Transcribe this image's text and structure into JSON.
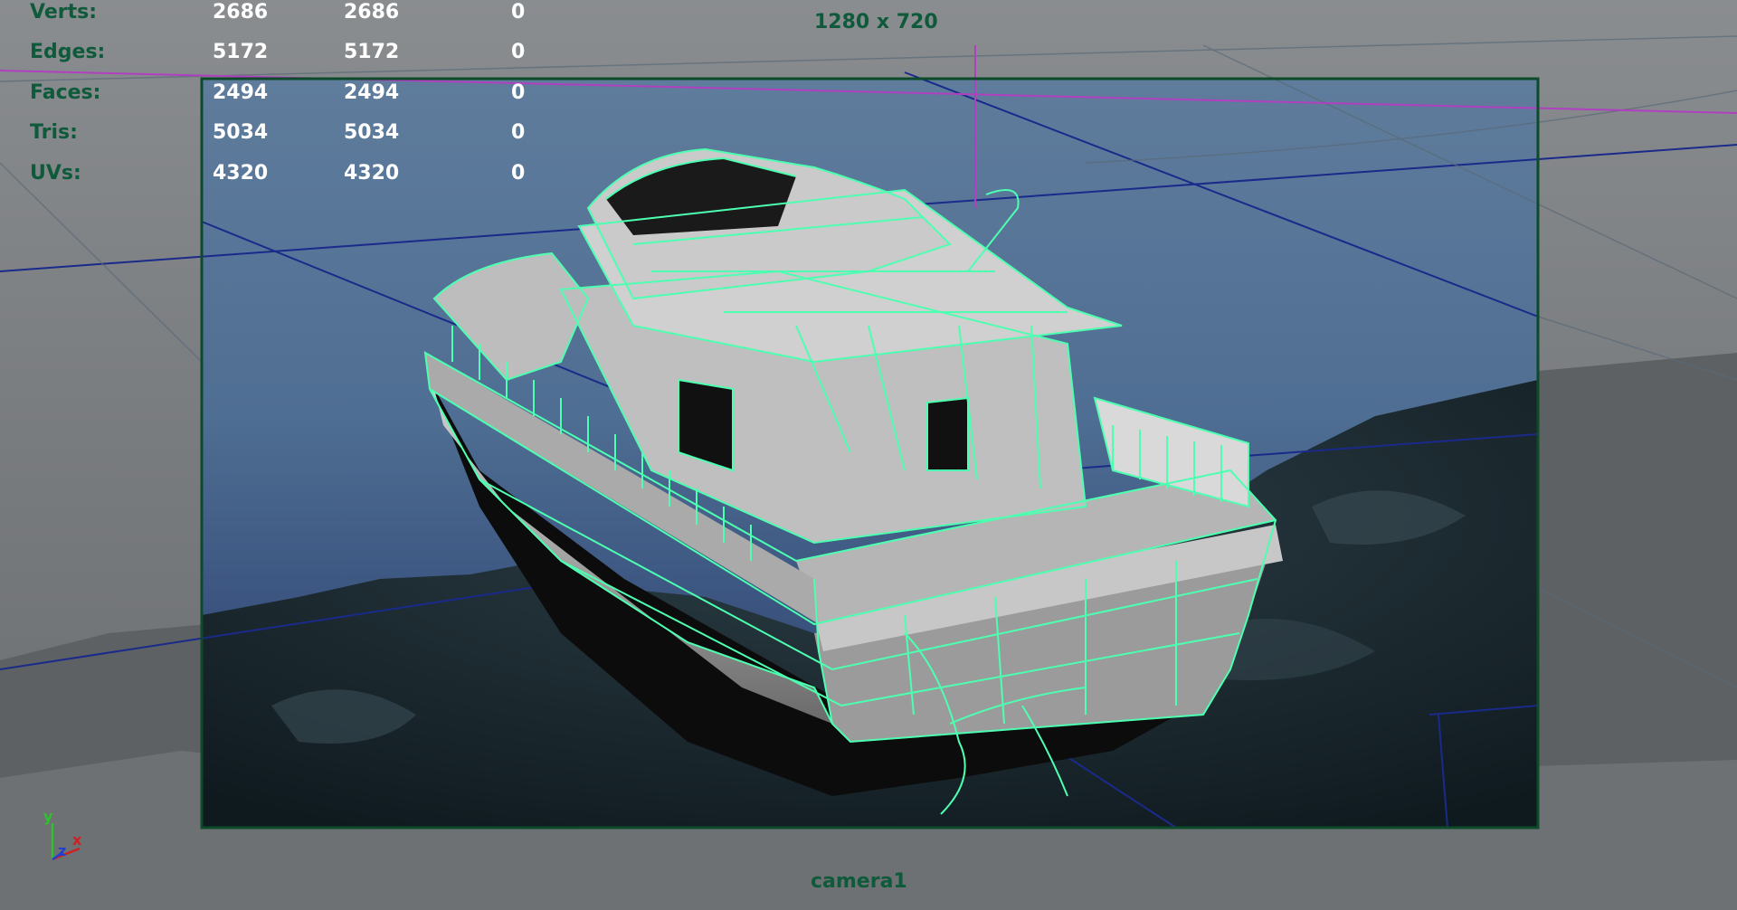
{
  "hud": {
    "rows": [
      {
        "label": "Verts:",
        "a": "2686",
        "b": "2686",
        "c": "0"
      },
      {
        "label": "Edges:",
        "a": "5172",
        "b": "5172",
        "c": "0"
      },
      {
        "label": "Faces:",
        "a": "2494",
        "b": "2494",
        "c": "0"
      },
      {
        "label": "Tris:",
        "a": "5034",
        "b": "5034",
        "c": "0"
      },
      {
        "label": "UVs:",
        "a": "4320",
        "b": "4320",
        "c": "0"
      }
    ]
  },
  "viewport": {
    "resolution": "1280 x 720",
    "camera_name": "camera1"
  },
  "axis": {
    "y": "y",
    "z": "z",
    "x": "x"
  },
  "colors": {
    "hud_label": "#0f5a3a",
    "hud_value": "#ffffff",
    "selection_wireframe": "#4dffb0",
    "resolution_gate": "#0d4a2a",
    "background": "#7a7d80"
  }
}
